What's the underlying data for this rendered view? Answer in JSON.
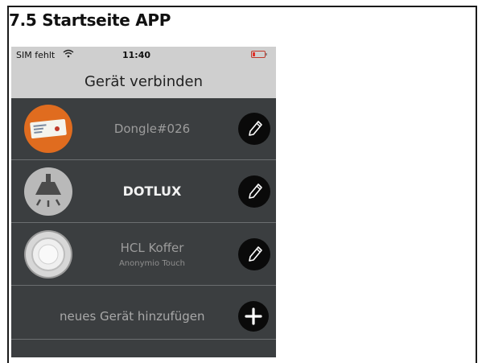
{
  "section_title": "7.5 Startseite APP",
  "status_bar": {
    "carrier": "SIM fehlt",
    "time": "11:40",
    "icons": [
      "wifi-icon",
      "battery-low-icon"
    ]
  },
  "nav": {
    "title": "Gerät verbinden"
  },
  "devices": [
    {
      "name": "Dongle#026",
      "subtitle": "",
      "icon": "dongle-thumbnail",
      "action_icon": "pencil-icon"
    },
    {
      "name": "DOTLUX",
      "subtitle": "",
      "icon": "lamp-thumbnail",
      "action_icon": "pencil-icon"
    },
    {
      "name": "HCL Koffer",
      "subtitle": "Anonymio Touch",
      "icon": "round-device-thumbnail",
      "action_icon": "pencil-icon"
    }
  ],
  "add_device": {
    "label": "neues Gerät hinzufügen",
    "icon": "plus-icon"
  },
  "colors": {
    "list_background": "#3b3e40",
    "bar_background": "#cfcfcf",
    "battery_low": "#e0302a",
    "dongle_thumb": "#e06c1f"
  }
}
